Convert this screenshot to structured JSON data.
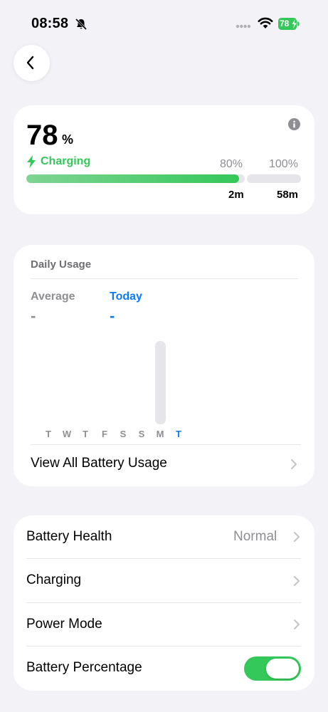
{
  "status_bar": {
    "time": "08:58",
    "battery_level": "78",
    "icons": [
      "bell-slash-icon",
      "signal-dots-icon",
      "wifi-icon",
      "battery-charging-icon"
    ]
  },
  "battery": {
    "percent": "78",
    "percent_sign": "%",
    "charging_label": "Charging",
    "marker_80": "80%",
    "marker_100": "100%",
    "time_to_80": "2m",
    "time_to_100": "58m",
    "charge_level": 0.78
  },
  "daily_usage": {
    "title": "Daily Usage",
    "average_label": "Average",
    "average_value": "-",
    "today_label": "Today",
    "today_value": "-",
    "days": [
      "T",
      "W",
      "T",
      "F",
      "S",
      "S",
      "M",
      "T"
    ],
    "view_all_label": "View All Battery Usage"
  },
  "settings": {
    "battery_health_label": "Battery Health",
    "battery_health_value": "Normal",
    "charging_label": "Charging",
    "power_mode_label": "Power Mode",
    "battery_percentage_label": "Battery Percentage",
    "battery_percentage_enabled": true
  },
  "colors": {
    "accent_green": "#34c759",
    "accent_blue": "#0a7aff",
    "background": "#f2f2f7"
  }
}
